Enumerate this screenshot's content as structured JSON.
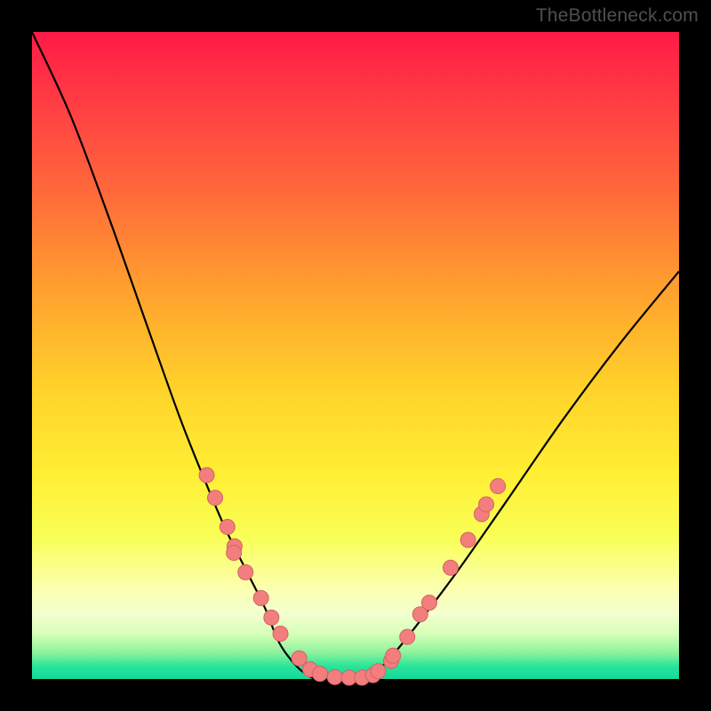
{
  "watermark": "TheBottleneck.com",
  "colors": {
    "frame": "#000000",
    "curve": "#000000",
    "dot_fill": "#f37e7e",
    "dot_stroke": "#d46363"
  },
  "chart_data": {
    "type": "line",
    "title": "",
    "xlabel": "",
    "ylabel": "",
    "xlim": [
      0,
      1
    ],
    "ylim": [
      0,
      1
    ],
    "series": [
      {
        "name": "bottleneck-curve",
        "x": [
          0.0,
          0.06,
          0.12,
          0.18,
          0.23,
          0.27,
          0.3,
          0.33,
          0.36,
          0.38,
          0.4,
          0.42,
          0.44,
          0.47,
          0.5,
          0.53,
          0.56,
          0.6,
          0.66,
          0.73,
          0.82,
          0.91,
          1.0
        ],
        "y": [
          1.0,
          0.87,
          0.71,
          0.54,
          0.4,
          0.3,
          0.23,
          0.17,
          0.11,
          0.06,
          0.03,
          0.01,
          0.0,
          0.0,
          0.0,
          0.01,
          0.04,
          0.09,
          0.17,
          0.27,
          0.4,
          0.52,
          0.63
        ]
      }
    ],
    "highlight_dots": [
      {
        "x": 0.27,
        "y": 0.315
      },
      {
        "x": 0.283,
        "y": 0.28
      },
      {
        "x": 0.302,
        "y": 0.235
      },
      {
        "x": 0.313,
        "y": 0.205
      },
      {
        "x": 0.312,
        "y": 0.195
      },
      {
        "x": 0.33,
        "y": 0.165
      },
      {
        "x": 0.354,
        "y": 0.125
      },
      {
        "x": 0.37,
        "y": 0.095
      },
      {
        "x": 0.384,
        "y": 0.07
      },
      {
        "x": 0.413,
        "y": 0.032
      },
      {
        "x": 0.43,
        "y": 0.015
      },
      {
        "x": 0.445,
        "y": 0.008
      },
      {
        "x": 0.468,
        "y": 0.003
      },
      {
        "x": 0.49,
        "y": 0.002
      },
      {
        "x": 0.51,
        "y": 0.002
      },
      {
        "x": 0.527,
        "y": 0.006
      },
      {
        "x": 0.535,
        "y": 0.012
      },
      {
        "x": 0.555,
        "y": 0.028
      },
      {
        "x": 0.558,
        "y": 0.036
      },
      {
        "x": 0.58,
        "y": 0.065
      },
      {
        "x": 0.6,
        "y": 0.1
      },
      {
        "x": 0.614,
        "y": 0.118
      },
      {
        "x": 0.647,
        "y": 0.172
      },
      {
        "x": 0.674,
        "y": 0.215
      },
      {
        "x": 0.695,
        "y": 0.255
      },
      {
        "x": 0.702,
        "y": 0.27
      },
      {
        "x": 0.72,
        "y": 0.298
      }
    ]
  }
}
